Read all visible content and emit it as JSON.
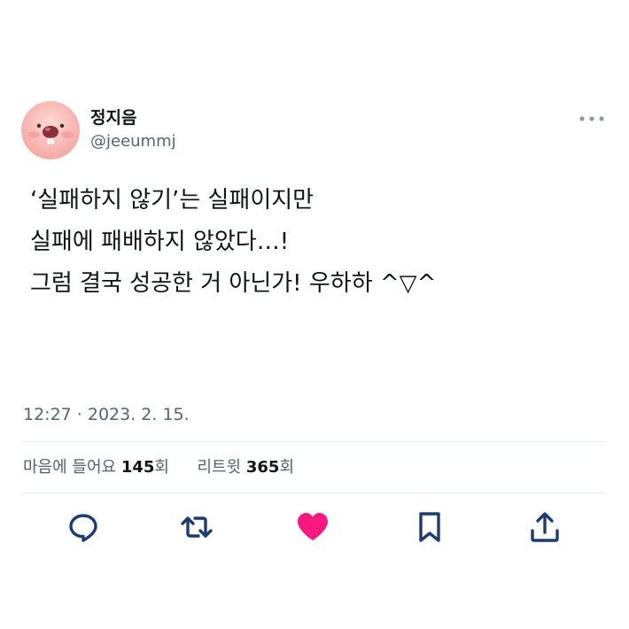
{
  "tweet": {
    "display_name": "정지음",
    "handle": "@jeeummj",
    "lines": [
      "‘실패하지 않기’는 실패이지만",
      "실패에 패배하지 않았다…!",
      "그럼 결국 성공한 거 아닌가! 우하하 ^▽^"
    ],
    "timestamp": "12:27 · 2023. 2. 15."
  },
  "stats": {
    "likes_label": "마음에 들어요",
    "likes_count": "145",
    "likes_suffix": "회",
    "retweets_label": "리트윗",
    "retweets_count": "365",
    "retweets_suffix": "회"
  },
  "actions": [
    "reply-icon",
    "retweet-icon",
    "like-icon",
    "bookmark-icon",
    "share-icon"
  ],
  "colors": {
    "text": "#0f1419",
    "secondary": "#536471",
    "icon_blue": "#1d3d72",
    "like_red": "#f91880",
    "divider": "#e6ecf0"
  }
}
